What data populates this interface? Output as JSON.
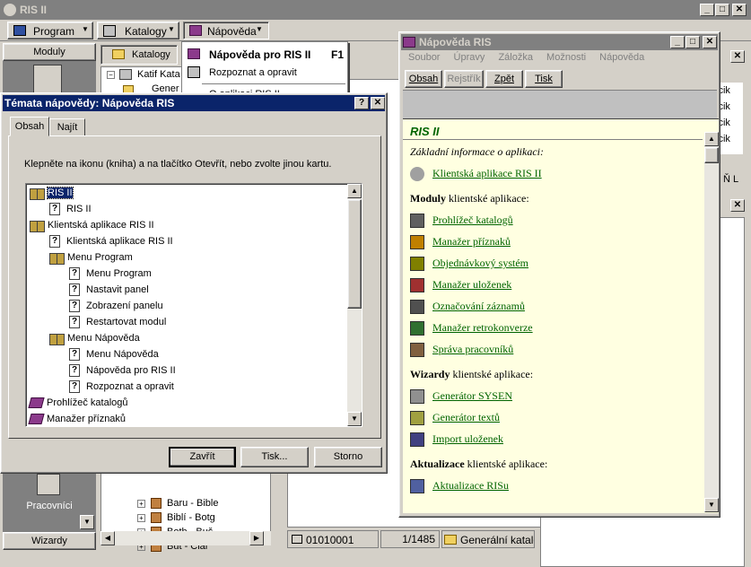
{
  "app": {
    "title": "RIS II"
  },
  "menubar": [
    {
      "label": "Program"
    },
    {
      "label": "Katalogy"
    },
    {
      "label": "Nápověda"
    }
  ],
  "help_menu": {
    "items": [
      {
        "label": "Nápověda pro RIS II",
        "shortcut": "F1"
      },
      {
        "label": "Rozpoznat a opravit",
        "shortcut": ""
      },
      {
        "label": "O aplikaci RIS II",
        "shortcut": ""
      }
    ]
  },
  "left_panel": {
    "top_label": "Moduly",
    "bottom_button": "Pracovníci",
    "bottom_label": "Wizardy"
  },
  "catalog_panel": {
    "button": "Katalogy",
    "tree_root": "Katif Kata",
    "tree_child": "Gener",
    "items": [
      "Baru - Bible",
      "Biblí - Botg",
      "Both - Buš",
      "But - Clar"
    ]
  },
  "status_bar": {
    "code": "01010001",
    "page": "1/1485",
    "catalog": "Generální katalog"
  },
  "right_partial": {
    "rows": [
      "icik",
      "icik",
      "icik",
      "icik"
    ],
    "label": "Ň L"
  },
  "topics_dialog": {
    "title": "Témata nápovědy: Nápověda RIS",
    "tabs": [
      "Obsah",
      "Najít"
    ],
    "instruction": "Klepněte na ikonu (kniha) a na tlačítko Otevřít, nebo zvolte jinou kartu.",
    "tree": [
      {
        "type": "open-book",
        "label": "RIS II",
        "indent": 0,
        "selected": true
      },
      {
        "type": "page",
        "label": "RIS II",
        "indent": 1
      },
      {
        "type": "open-book",
        "label": "Klientská aplikace RIS II",
        "indent": 0
      },
      {
        "type": "page",
        "label": "Klientská aplikace RIS II",
        "indent": 1
      },
      {
        "type": "open-book",
        "label": "Menu Program",
        "indent": 1
      },
      {
        "type": "page",
        "label": "Menu Program",
        "indent": 2
      },
      {
        "type": "page",
        "label": "Nastavit panel",
        "indent": 2
      },
      {
        "type": "page",
        "label": "Zobrazení panelu",
        "indent": 2
      },
      {
        "type": "page",
        "label": "Restartovat modul",
        "indent": 2
      },
      {
        "type": "open-book",
        "label": "Menu Nápověda",
        "indent": 1
      },
      {
        "type": "page",
        "label": "Menu Nápověda",
        "indent": 2
      },
      {
        "type": "page",
        "label": "Nápověda pro RIS II",
        "indent": 2
      },
      {
        "type": "page",
        "label": "Rozpoznat a opravit",
        "indent": 2
      },
      {
        "type": "closed-book",
        "label": "Prohlížeč katalogů",
        "indent": 0
      },
      {
        "type": "closed-book",
        "label": "Manažer příznaků",
        "indent": 0
      }
    ],
    "buttons": {
      "close": "Zavřít",
      "print": "Tisk...",
      "cancel": "Storno"
    }
  },
  "help_window": {
    "title": "Nápověda RIS",
    "menu": [
      "Soubor",
      "Úpravy",
      "Záložka",
      "Možnosti",
      "Nápověda"
    ],
    "toolbar": [
      "Obsah",
      "Rejstřík",
      "Zpět",
      "Tisk"
    ],
    "heading": "RIS II",
    "intro": "Základní informace o aplikaci:",
    "app_link": "Klientská aplikace RIS II",
    "modules_bold": "Moduly",
    "modules_rest": " klientské aplikace:",
    "modules": [
      "Prohlížeč katalogů",
      "Manažer příznaků",
      "Objednávkový systém",
      "Manažer uloženek",
      "Označování záznamů",
      "Manažer retrokonverze",
      "Správa pracovníků"
    ],
    "wizards_bold": "Wizardy",
    "wizards_rest": " klientské aplikace:",
    "wizards": [
      "Generátor SYSEN",
      "Generátor textů",
      "Import uloženek"
    ],
    "updates_bold": "Aktualizace",
    "updates_rest": " klientské aplikace:",
    "updates": [
      "Aktualizace RISu"
    ]
  }
}
